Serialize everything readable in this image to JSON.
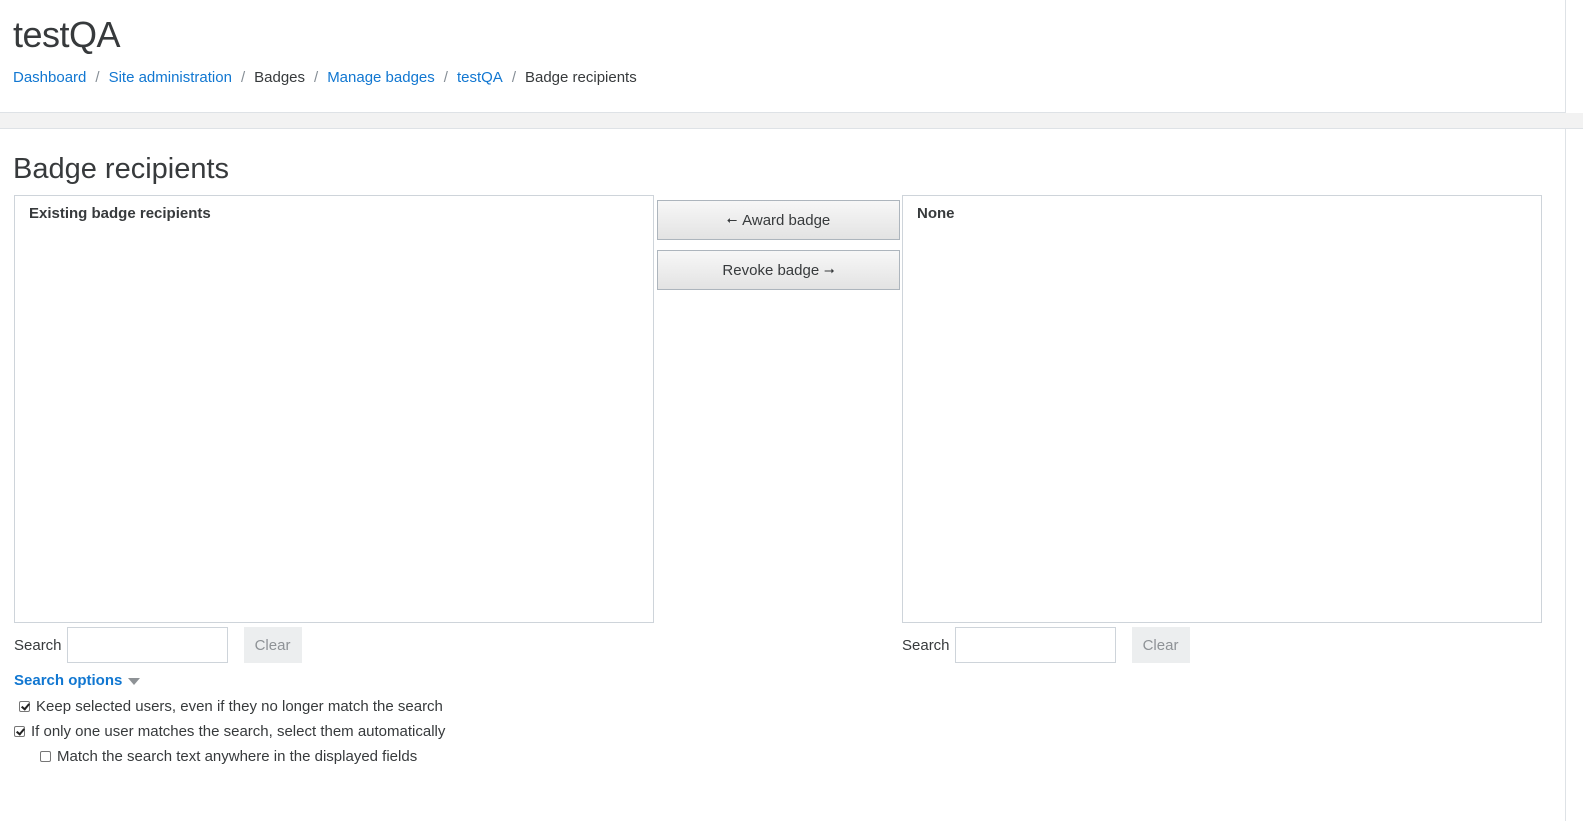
{
  "header": {
    "site_title": "testQA",
    "breadcrumb": [
      {
        "label": "Dashboard",
        "link": true
      },
      {
        "label": "Site administration",
        "link": true
      },
      {
        "label": "Badges",
        "link": false
      },
      {
        "label": "Manage badges",
        "link": true
      },
      {
        "label": "testQA",
        "link": true
      },
      {
        "label": "Badge recipients",
        "link": false
      }
    ],
    "separator": "/"
  },
  "main": {
    "heading": "Badge recipients",
    "existing_list": {
      "group_label": "Existing badge recipients"
    },
    "potential_list": {
      "group_label": "None"
    },
    "award_button": {
      "label": "Award badge",
      "arrow": "⭠"
    },
    "revoke_button": {
      "label": "Revoke badge",
      "arrow": "⭢"
    },
    "left_search": {
      "label": "Search",
      "value": "",
      "clear_label": "Clear"
    },
    "right_search": {
      "label": "Search",
      "value": "",
      "clear_label": "Clear"
    },
    "search_options": {
      "label": "Search options",
      "options": [
        {
          "label": "Keep selected users, even if they no longer match the search",
          "checked": true
        },
        {
          "label": "If only one user matches the search, select them automatically",
          "checked": true
        },
        {
          "label": "Match the search text anywhere in the displayed fields",
          "checked": false
        }
      ]
    }
  },
  "colors": {
    "link": "#1177d1",
    "text": "#373a3c",
    "band": "#f2f2f2"
  }
}
